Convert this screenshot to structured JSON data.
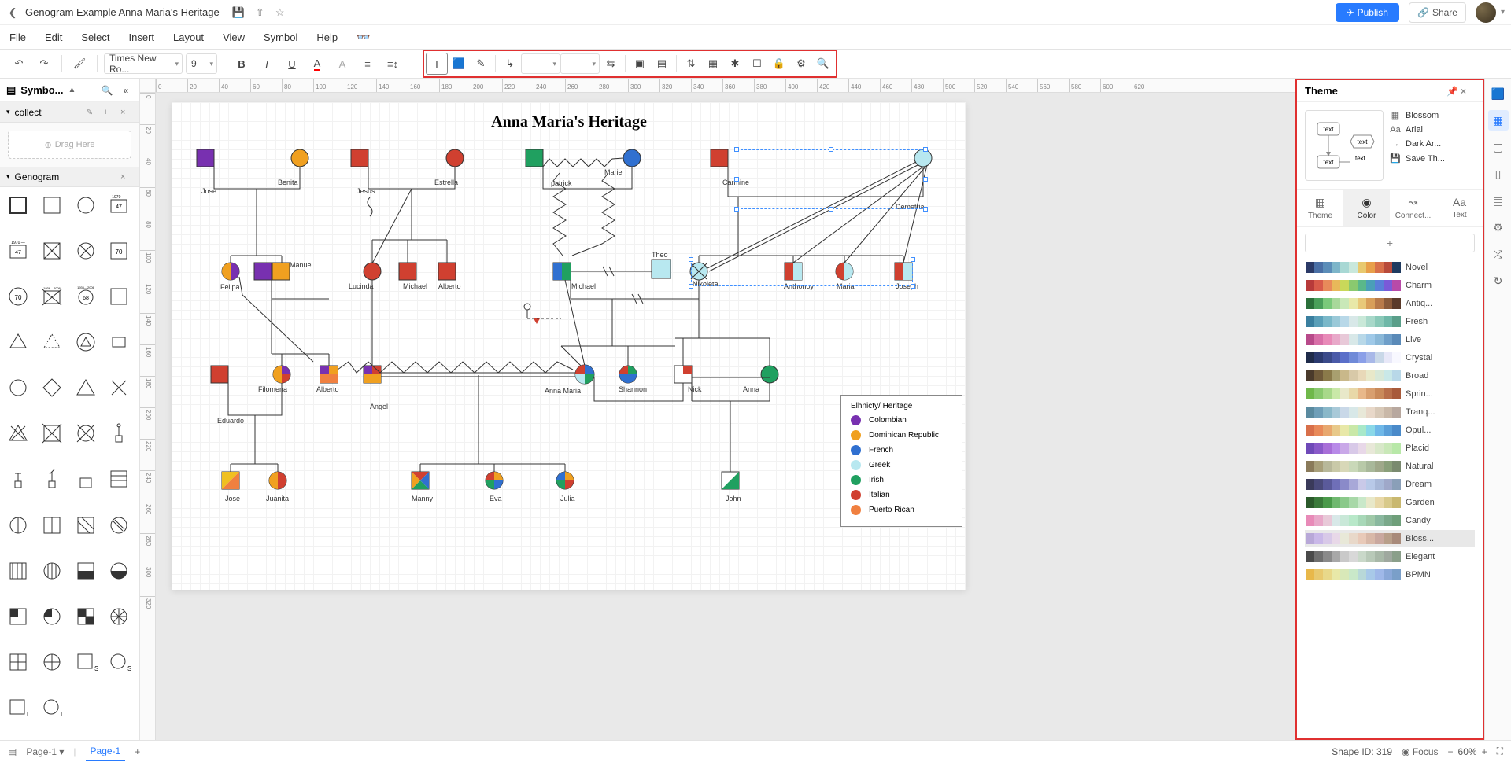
{
  "doc_title": "Genogram Example Anna Maria's Heritage",
  "menus": [
    "File",
    "Edit",
    "Select",
    "Insert",
    "Layout",
    "View",
    "Symbol",
    "Help"
  ],
  "publish_label": "Publish",
  "share_label": "Share",
  "toolbar": {
    "font": "Times New Ro...",
    "font_size": "9"
  },
  "left_panel": {
    "title": "Symbo...",
    "collect_label": "collect",
    "drag_here": "Drag Here",
    "genogram_label": "Genogram"
  },
  "diagram": {
    "title": "Anna Maria's Heritage",
    "people": {
      "jose1": "Jose",
      "benita": "Benita",
      "jesus": "Jesus",
      "estrella": "Estrella",
      "patrick": "patrick",
      "marie": "Marie",
      "carmine": "Carmine",
      "demetria": "Demetria",
      "manuel": "Manuel",
      "felipa": "Felipa",
      "lucinda": "Lucinda",
      "michael_u": "Michael",
      "alberto_u": "Alberto",
      "michael": "Michael",
      "theo": "Theo",
      "nikoleta": "Nikoleta",
      "anthonoy": "Anthonoy",
      "maria": "Maria",
      "joseph": "Joseph",
      "filomena": "Filomena",
      "alberto": "Alberto",
      "angel": "Angel",
      "anna_maria": "Anna Maria",
      "shannon": "Shannon",
      "nick": "Nick",
      "anna": "Anna",
      "eduardo": "Eduardo",
      "jose2": "Jose",
      "juanita": "Juanita",
      "manny": "Manny",
      "eva": "Eva",
      "julia": "Julia",
      "john": "John"
    },
    "legend_title": "Elhnicty/ Heritage",
    "legend": [
      {
        "label": "Colombian",
        "color": "#7830b0"
      },
      {
        "label": "Dominican Republic",
        "color": "#f0a020"
      },
      {
        "label": "French",
        "color": "#3070d0"
      },
      {
        "label": "Greek",
        "color": "#b8e8f0"
      },
      {
        "label": "Irish",
        "color": "#20a060"
      },
      {
        "label": "Italian",
        "color": "#d04030"
      },
      {
        "label": "Puerto Rican",
        "color": "#f08040"
      }
    ]
  },
  "ruler_h": [
    "0",
    "20",
    "40",
    "60",
    "80",
    "100",
    "120",
    "140",
    "160",
    "180",
    "200",
    "220",
    "240",
    "260",
    "280",
    "300",
    "320",
    "340",
    "360",
    "380",
    "400",
    "420",
    "440",
    "460",
    "480",
    "500",
    "520",
    "540",
    "560",
    "580",
    "600",
    "620"
  ],
  "ruler_v": [
    "0",
    "20",
    "40",
    "60",
    "80",
    "100",
    "120",
    "140",
    "160",
    "180",
    "200",
    "220",
    "240",
    "260",
    "280",
    "300",
    "320"
  ],
  "right_panel": {
    "title": "Theme",
    "opts": {
      "blossom": "Blossom",
      "arial": "Arial",
      "dark": "Dark Ar...",
      "save": "Save Th..."
    },
    "tabs": {
      "theme": "Theme",
      "color": "Color",
      "connect": "Connect...",
      "text": "Text"
    },
    "preview_text": "text",
    "color_themes": [
      "Novel",
      "Charm",
      "Antiq...",
      "Fresh",
      "Live",
      "Crystal",
      "Broad",
      "Sprin...",
      "Tranq...",
      "Opul...",
      "Placid",
      "Natural",
      "Dream",
      "Garden",
      "Candy",
      "Bloss...",
      "Elegant",
      "BPMN"
    ]
  },
  "status": {
    "page_dropdown": "Page-1",
    "page_tab": "Page-1",
    "shape_id_label": "Shape ID: 319",
    "focus_label": "Focus",
    "zoom": "60%"
  },
  "chart_data": {
    "type": "genogram",
    "note": "Family tree / genogram showing 4 generations with ethnicity color coding per legend."
  }
}
